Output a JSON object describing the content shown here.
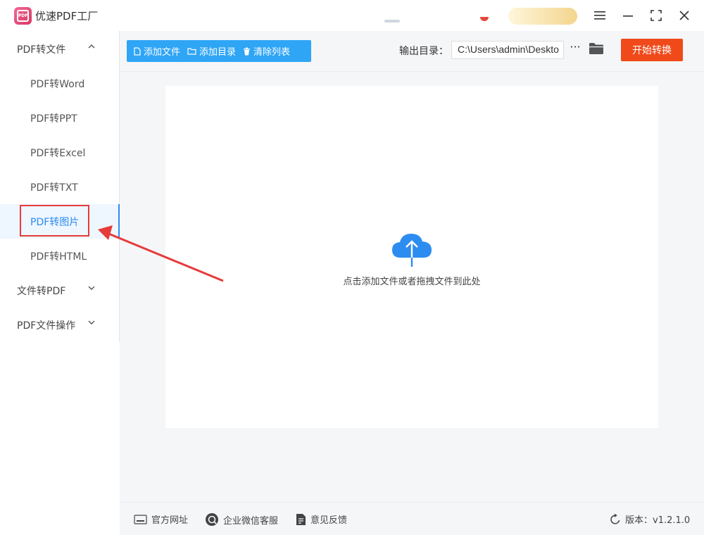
{
  "app": {
    "title": "优速PDF工厂",
    "logo_text": "PDF"
  },
  "sidebar": {
    "groups": [
      {
        "label": "PDF转文件",
        "expanded": true,
        "items": [
          "PDF转Word",
          "PDF转PPT",
          "PDF转Excel",
          "PDF转TXT",
          "PDF转图片",
          "PDF转HTML"
        ]
      },
      {
        "label": "文件转PDF",
        "expanded": false
      },
      {
        "label": "PDF文件操作",
        "expanded": false
      }
    ],
    "active_item": "PDF转图片"
  },
  "toolbar": {
    "add_file": "添加文件",
    "add_folder": "添加目录",
    "clear_list": "清除列表",
    "output_label": "输出目录：",
    "output_path": "C:\\Users\\admin\\Deskto",
    "more": "···",
    "start": "开始转换"
  },
  "dropzone": {
    "hint": "点击添加文件或者拖拽文件到此处"
  },
  "footer": {
    "website": "官方网址",
    "wechat_service": "企业微信客服",
    "feedback": "意见反馈",
    "version": "版本：v1.2.1.0"
  },
  "colors": {
    "accent": "#2d8cf0",
    "toolbar": "#2fa5f6",
    "start": "#f04a1b",
    "annotation": "#e63b3b"
  }
}
